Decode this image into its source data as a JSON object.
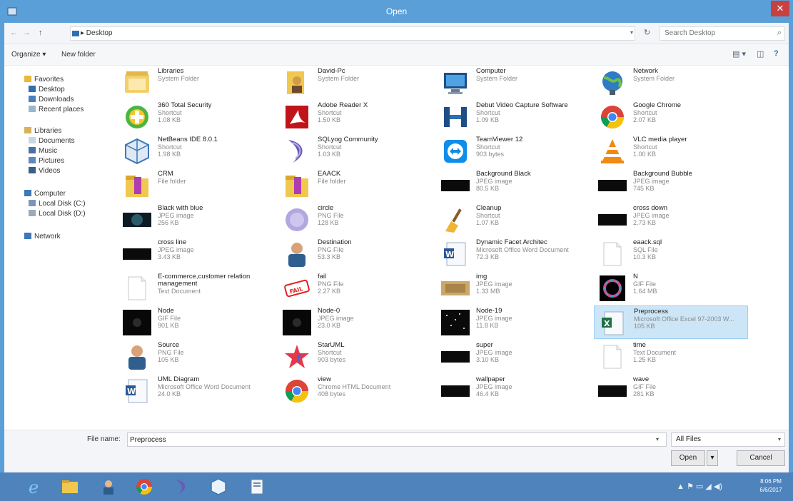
{
  "window": {
    "title": "Open",
    "close": "✕"
  },
  "address": {
    "back": "←",
    "forward": "→",
    "up": "↑",
    "breadcrumb": "▸  Desktop",
    "chevron": "▾",
    "refresh": "↻",
    "search_placeholder": "Search Desktop",
    "search_icon": "⌕"
  },
  "toolbar": {
    "organize": "Organize ▾",
    "new_folder": "New folder",
    "view_icon": "▤ ▾",
    "pane_icon": "◫",
    "help_icon": "?"
  },
  "nav": {
    "favorites": "Favorites",
    "desktop": "Desktop",
    "downloads": "Downloads",
    "recent": "Recent places",
    "libraries": "Libraries",
    "documents": "Documents",
    "music": "Music",
    "pictures": "Pictures",
    "videos": "Videos",
    "computer": "Computer",
    "local_c": "Local Disk (C:)",
    "local_d": "Local Disk (D:)",
    "network": "Network"
  },
  "files": [
    {
      "name": "Libraries",
      "type": "System Folder",
      "size": "",
      "icon": "libraries-icon"
    },
    {
      "name": "David-Pc",
      "type": "System Folder",
      "size": "",
      "icon": "user-folder-icon"
    },
    {
      "name": "Computer",
      "type": "System Folder",
      "size": "",
      "icon": "computer-icon"
    },
    {
      "name": "Network",
      "type": "System Folder",
      "size": "",
      "icon": "network-icon"
    },
    {
      "name": "360 Total Security",
      "type": "Shortcut",
      "size": "1.08 KB",
      "icon": "security-icon"
    },
    {
      "name": "Adobe Reader X",
      "type": "Shortcut",
      "size": "1.50 KB",
      "icon": "adobe-icon"
    },
    {
      "name": "Debut Video Capture Software",
      "type": "Shortcut",
      "size": "1.09 KB",
      "icon": "debut-icon"
    },
    {
      "name": "Google Chrome",
      "type": "Shortcut",
      "size": "2.07 KB",
      "icon": "chrome-icon"
    },
    {
      "name": "NetBeans IDE 8.0.1",
      "type": "Shortcut",
      "size": "1.98 KB",
      "icon": "netbeans-icon"
    },
    {
      "name": "SQLyog Community",
      "type": "Shortcut",
      "size": "1.03 KB",
      "icon": "sqlyog-icon"
    },
    {
      "name": "TeamViewer 12",
      "type": "Shortcut",
      "size": "903 bytes",
      "icon": "teamviewer-icon"
    },
    {
      "name": "VLC media player",
      "type": "Shortcut",
      "size": "1.00 KB",
      "icon": "vlc-icon"
    },
    {
      "name": "CRM",
      "type": "File folder",
      "size": "",
      "icon": "folder-icon"
    },
    {
      "name": "EAACK",
      "type": "File folder",
      "size": "",
      "icon": "folder-icon"
    },
    {
      "name": "Background Black",
      "type": "JPEG image",
      "size": "80.5 KB",
      "icon": "image-dark-icon"
    },
    {
      "name": "Background Bubble",
      "type": "JPEG image",
      "size": "745 KB",
      "icon": "image-dark-icon"
    },
    {
      "name": "Black with blue",
      "type": "JPEG image",
      "size": "256 KB",
      "icon": "image-blue-icon"
    },
    {
      "name": "circle",
      "type": "PNG File",
      "size": "128 KB",
      "icon": "circle-icon"
    },
    {
      "name": "Cleanup",
      "type": "Shortcut",
      "size": "1.07 KB",
      "icon": "broom-icon"
    },
    {
      "name": "cross down",
      "type": "JPEG image",
      "size": "2.73 KB",
      "icon": "image-dark-icon"
    },
    {
      "name": "cross line",
      "type": "JPEG image",
      "size": "3.43 KB",
      "icon": "image-dark-icon"
    },
    {
      "name": "Destination",
      "type": "PNG File",
      "size": "53.3 KB",
      "icon": "person-icon"
    },
    {
      "name": "Dynamic Facet Architec",
      "type": "Microsoft Office Word Document",
      "size": "72.3 KB",
      "icon": "word-icon"
    },
    {
      "name": "eaack.sql",
      "type": "SQL File",
      "size": "10.3 KB",
      "icon": "document-icon"
    },
    {
      "name": "E-commerce,customer relation management",
      "type": "Text Document",
      "size": "",
      "icon": "document-icon"
    },
    {
      "name": "fail",
      "type": "PNG File",
      "size": "2.27 KB",
      "icon": "fail-stamp-icon"
    },
    {
      "name": "img",
      "type": "JPEG image",
      "size": "1.33 MB",
      "icon": "image-gold-icon"
    },
    {
      "name": "N",
      "type": "GIF File",
      "size": "1.64 MB",
      "icon": "image-ring-icon"
    },
    {
      "name": "Node",
      "type": "GIF File",
      "size": "901 KB",
      "icon": "image-node-icon"
    },
    {
      "name": "Node-0",
      "type": "JPEG image",
      "size": "23.0 KB",
      "icon": "image-node-icon"
    },
    {
      "name": "Node-19",
      "type": "JPEG image",
      "size": "11.8 KB",
      "icon": "image-stars-icon"
    },
    {
      "name": "Preprocess",
      "type": "Microsoft Office Excel 97-2003 W...",
      "size": "105 KB",
      "icon": "excel-icon"
    },
    {
      "name": "Source",
      "type": "PNG File",
      "size": "105 KB",
      "icon": "person-icon"
    },
    {
      "name": "StarUML",
      "type": "Shortcut",
      "size": "903 bytes",
      "icon": "staruml-icon"
    },
    {
      "name": "super",
      "type": "JPEG image",
      "size": "3.10 KB",
      "icon": "image-dark-icon"
    },
    {
      "name": "time",
      "type": "Text Document",
      "size": "1.25 KB",
      "icon": "document-icon"
    },
    {
      "name": "UML Diagram",
      "type": "Microsoft Office Word Document",
      "size": "24.0 KB",
      "icon": "word-icon"
    },
    {
      "name": "view",
      "type": "Chrome HTML Document",
      "size": "408 bytes",
      "icon": "chrome-icon"
    },
    {
      "name": "wallpaper",
      "type": "JPEG image",
      "size": "46.4 KB",
      "icon": "image-dark-icon"
    },
    {
      "name": "wave",
      "type": "GIF File",
      "size": "281 KB",
      "icon": "image-dark-icon"
    }
  ],
  "footer": {
    "file_name_label": "File name:",
    "file_name_value": "Preprocess",
    "dropdown": "▾",
    "filter_value": "All Files",
    "open": "Open",
    "open_split": "▾",
    "cancel": "Cancel"
  },
  "taskbar": {
    "tray": "▲  ⚑  ▭  ◢  ◀)",
    "time": "8:06 PM",
    "date": "6/6/2017"
  }
}
